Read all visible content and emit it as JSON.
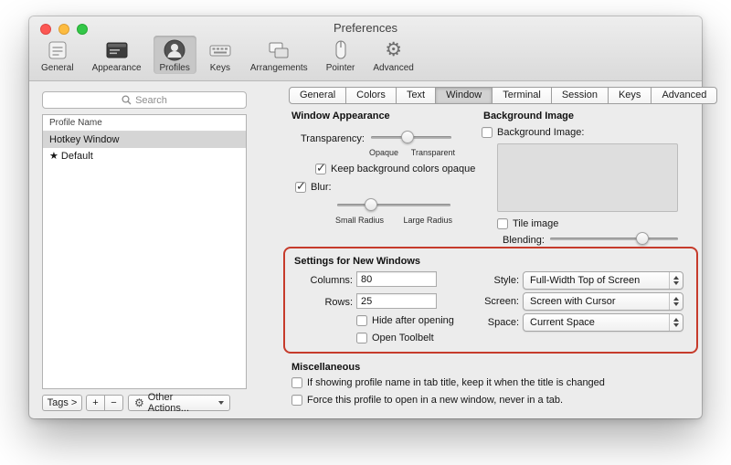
{
  "window": {
    "title": "Preferences"
  },
  "toolbar": {
    "selected": "Profiles",
    "items": [
      {
        "label": "General"
      },
      {
        "label": "Appearance"
      },
      {
        "label": "Profiles"
      },
      {
        "label": "Keys"
      },
      {
        "label": "Arrangements"
      },
      {
        "label": "Pointer"
      },
      {
        "label": "Advanced"
      }
    ]
  },
  "sidebar": {
    "search": {
      "placeholder": "Search"
    },
    "list_header": "Profile Name",
    "profiles": [
      {
        "name": "Hotkey Window",
        "selected": true
      },
      {
        "name": "★ Default",
        "selected": false
      }
    ],
    "tags_label": "Tags >",
    "add_label": "+",
    "remove_label": "−",
    "other_actions_label": "Other Actions..."
  },
  "tabs": {
    "selected": "Window",
    "items": [
      "General",
      "Colors",
      "Text",
      "Window",
      "Terminal",
      "Session",
      "Keys",
      "Advanced"
    ]
  },
  "window_appearance": {
    "title": "Window Appearance",
    "transparency_label": "Transparency:",
    "transparency_min": "Opaque",
    "transparency_max": "Transparent",
    "transparency_value": 0.45,
    "keep_opaque_label": "Keep background colors opaque",
    "keep_opaque_checked": true,
    "blur_label": "Blur:",
    "blur_checked": true,
    "blur_min": "Small Radius",
    "blur_max": "Large Radius",
    "blur_value": 0.3
  },
  "background_image": {
    "title": "Background Image",
    "image_label": "Background Image:",
    "image_checked": false,
    "tile_label": "Tile image",
    "tile_checked": false,
    "blending_label": "Blending:",
    "blending_value": 0.72
  },
  "settings_new_windows": {
    "title": "Settings for New Windows",
    "columns_label": "Columns:",
    "columns_value": "80",
    "rows_label": "Rows:",
    "rows_value": "25",
    "hide_after_opening_label": "Hide after opening",
    "hide_after_opening_checked": false,
    "open_toolbelt_label": "Open Toolbelt",
    "open_toolbelt_checked": false,
    "style_label": "Style:",
    "style_value": "Full-Width Top of Screen",
    "screen_label": "Screen:",
    "screen_value": "Screen with Cursor",
    "space_label": "Space:",
    "space_value": "Current Space"
  },
  "miscellaneous": {
    "title": "Miscellaneous",
    "profile_name_label": "If showing profile name in tab title, keep it when the title is changed",
    "profile_name_checked": false,
    "force_window_label": "Force this profile to open in a new window, never in a tab.",
    "force_window_checked": false
  },
  "annotation": {
    "color": "#c63b2b"
  }
}
